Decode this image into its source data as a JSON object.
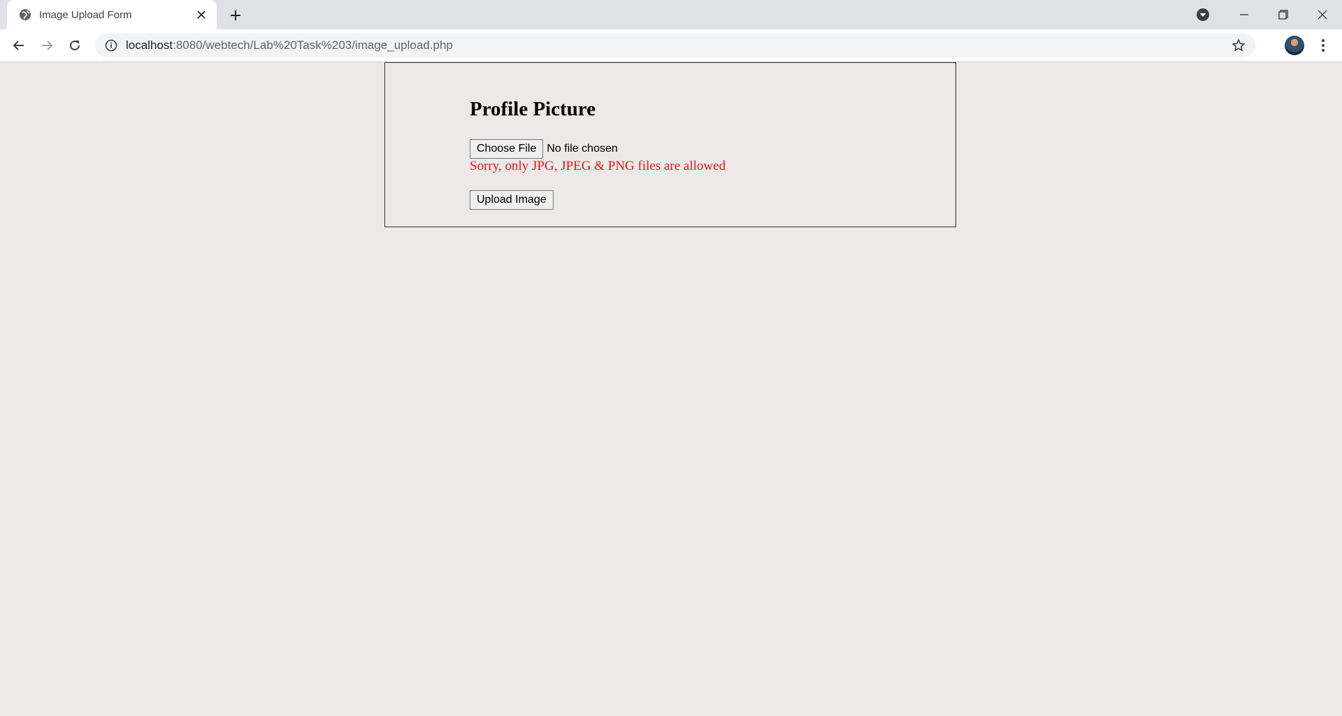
{
  "browser": {
    "tab_title": "Image Upload Form",
    "url_host": "localhost",
    "url_rest": ":8080/webtech/Lab%20Task%203/image_upload.php"
  },
  "page": {
    "heading": "Profile Picture",
    "choose_file_label": "Choose File",
    "file_status": "No file chosen",
    "error_message": "Sorry, only JPG, JPEG & PNG files are allowed",
    "upload_label": "Upload Image"
  },
  "colors": {
    "page_bg": "#ede9e8",
    "error": "#e8141c"
  },
  "icons": [
    "globe-icon",
    "close-icon",
    "plus-icon",
    "profile-dropdown-icon",
    "minimize-icon",
    "restore-icon",
    "window-close-icon",
    "back-icon",
    "forward-icon",
    "reload-icon",
    "info-icon",
    "star-icon",
    "kebab-menu-icon"
  ]
}
